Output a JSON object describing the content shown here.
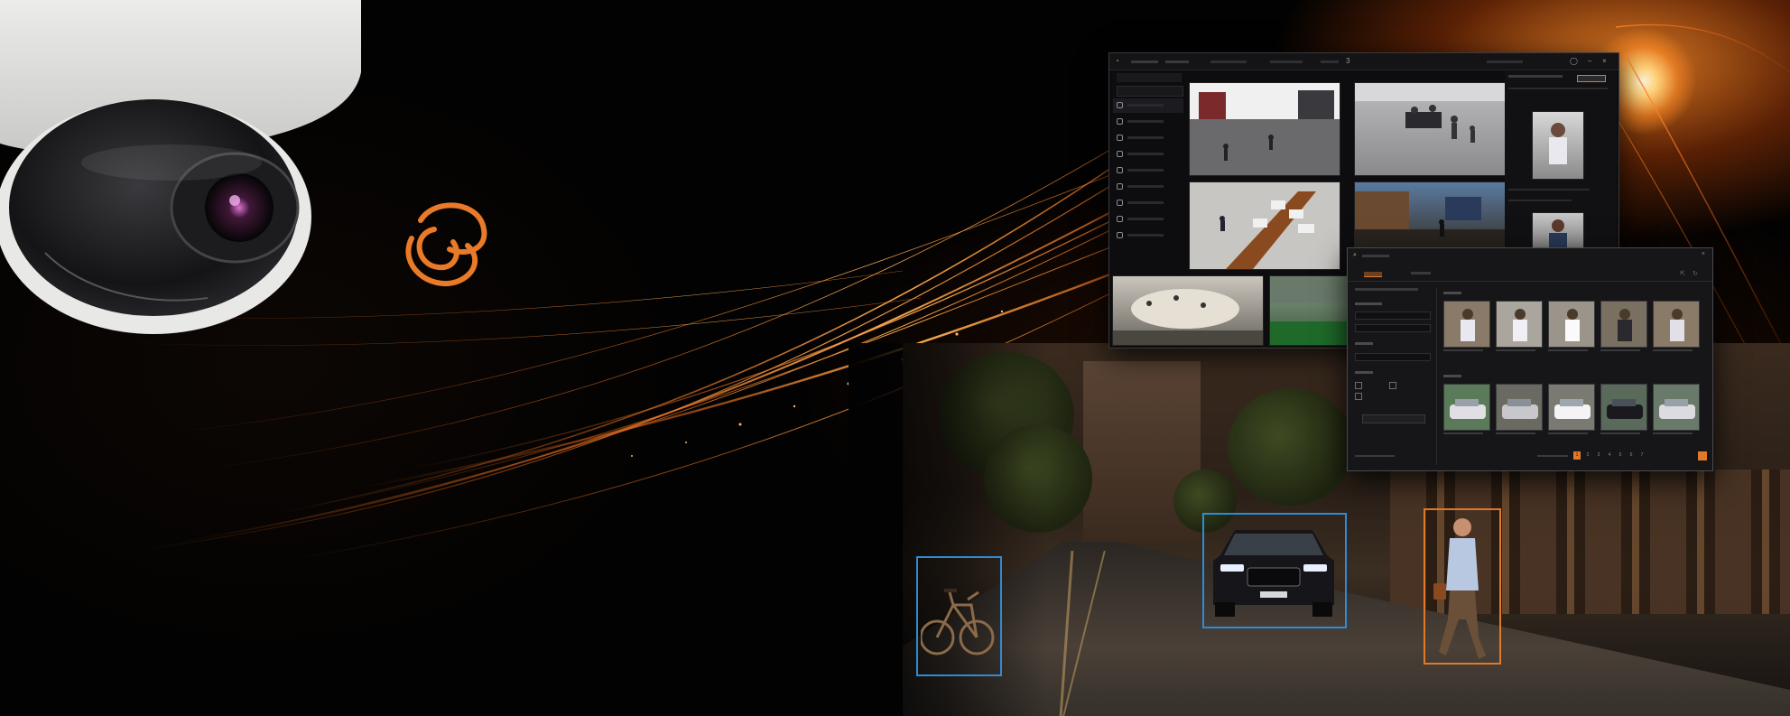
{
  "colors": {
    "accent_orange": "#e97a28",
    "detection_blue": "#2f8bd8",
    "detection_orange": "#e07a2a",
    "background": "#020202",
    "panel_dark": "#0d0d0f"
  },
  "icons": {
    "logo": "interlocking-orange-rings-logo",
    "camera": "dome-security-camera"
  },
  "vms_window": {
    "tab_badge": "3"
  },
  "search_dialog": {
    "results_pager": [
      "1",
      "2",
      "3",
      "4",
      "5",
      "6",
      "7"
    ],
    "active_page": "1"
  },
  "detections": [
    {
      "label": "bicycle",
      "color": "blue"
    },
    {
      "label": "car",
      "color": "blue"
    },
    {
      "label": "person",
      "color": "orange"
    }
  ]
}
